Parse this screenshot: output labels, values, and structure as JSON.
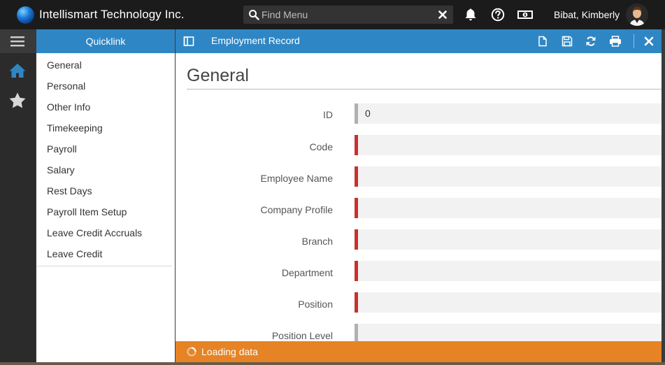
{
  "app": {
    "title": "Intellismart Technology Inc.",
    "user_name": "Bibat, Kimberly"
  },
  "search": {
    "placeholder": "Find Menu",
    "value": ""
  },
  "quicklink": {
    "header": "Quicklink",
    "items": [
      {
        "label": "General"
      },
      {
        "label": "Personal"
      },
      {
        "label": "Other Info"
      },
      {
        "label": "Timekeeping"
      },
      {
        "label": "Payroll"
      },
      {
        "label": "Salary"
      },
      {
        "label": "Rest Days"
      },
      {
        "label": "Payroll Item Setup"
      },
      {
        "label": "Leave Credit Accruals"
      },
      {
        "label": "Leave Credit"
      }
    ]
  },
  "main": {
    "header_title": "Employment Record",
    "section_title": "General",
    "fields": [
      {
        "label": "ID",
        "value": "0",
        "required": false
      },
      {
        "label": "Code",
        "value": "",
        "required": true
      },
      {
        "label": "Employee Name",
        "value": "",
        "required": true
      },
      {
        "label": "Company Profile",
        "value": "",
        "required": true
      },
      {
        "label": "Branch",
        "value": "",
        "required": true
      },
      {
        "label": "Department",
        "value": "",
        "required": true
      },
      {
        "label": "Position",
        "value": "",
        "required": true
      },
      {
        "label": "Position Level",
        "value": "",
        "required": false
      }
    ]
  },
  "status": {
    "text": "Loading data"
  },
  "colors": {
    "header_blue": "#2f86c4",
    "required_red": "#c8312f",
    "status_orange": "#e58325",
    "rail_active_blue": "#2f86c4"
  },
  "icons": {
    "search": "search-icon",
    "clear": "close-icon",
    "bell": "bell-icon",
    "help": "help-icon",
    "money": "money-icon",
    "menu": "hamburger-icon",
    "home": "home-icon",
    "favorites": "star-icon",
    "panel_toggle": "sidebar-toggle-icon",
    "new": "new-document-icon",
    "save": "save-icon",
    "refresh": "refresh-icon",
    "print": "print-icon",
    "close": "close-icon",
    "loading": "spinner-icon"
  }
}
